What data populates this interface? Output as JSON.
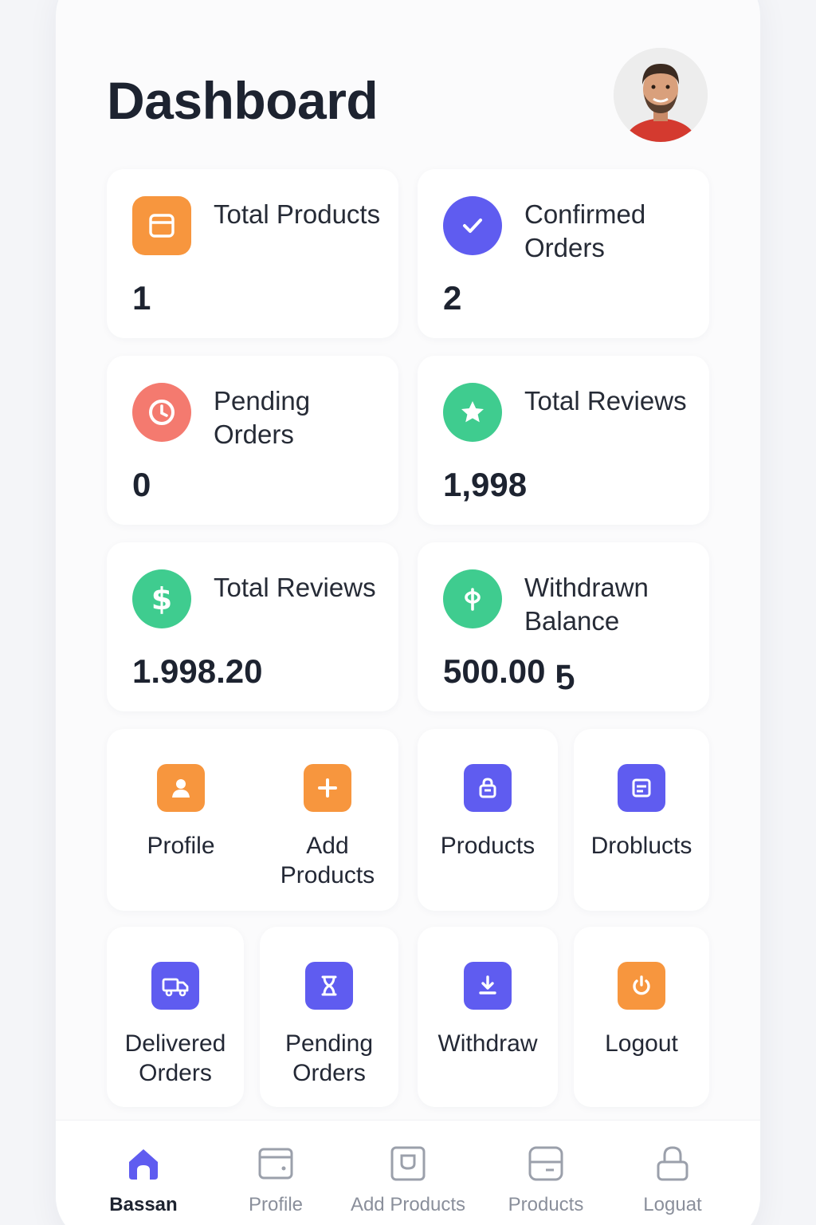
{
  "header": {
    "title": "Dashboard"
  },
  "stats": [
    {
      "label": "Total Products",
      "value": "1",
      "icon": "box-icon",
      "color": "#f7963e"
    },
    {
      "label": "Confirmed Orders",
      "value": "2",
      "icon": "check-icon",
      "color": "#5f5cf0"
    },
    {
      "label": "Pending Orders",
      "value": "0",
      "icon": "clock-icon",
      "color": "#f47a6f"
    },
    {
      "label": "Total Reviews",
      "value": "1,998",
      "icon": "star-icon",
      "color": "#3fcc8f"
    },
    {
      "label": "Total Reviews",
      "value": "1.998.20",
      "icon": "dollar-icon",
      "color": "#3fcc8f"
    },
    {
      "label": "Withdrawn Balance",
      "value": "500.00 ҕ",
      "icon": "currency-icon",
      "color": "#3fcc8f"
    }
  ],
  "actions": [
    {
      "label": "Profile",
      "icon": "user-icon",
      "color": "#f7963e"
    },
    {
      "label": "Add Products",
      "icon": "plus-icon",
      "color": "#f7963e"
    },
    {
      "label": "Products",
      "icon": "lock-bag-icon",
      "color": "#5f5cf0"
    },
    {
      "label": "Droblucts",
      "icon": "list-icon",
      "color": "#5f5cf0"
    },
    {
      "label": "Delivered Orders",
      "icon": "truck-icon",
      "color": "#5f5cf0"
    },
    {
      "label": "Pending Orders",
      "icon": "hourglass-icon",
      "color": "#5f5cf0"
    },
    {
      "label": "Withdraw",
      "icon": "download-icon",
      "color": "#5f5cf0"
    },
    {
      "label": "Logout",
      "icon": "power-icon",
      "color": "#f7963e"
    }
  ],
  "nav": [
    {
      "label": "Bassan",
      "icon": "home-icon",
      "active": true
    },
    {
      "label": "Profile",
      "icon": "wallet-icon"
    },
    {
      "label": "Add Products",
      "icon": "tag-icon"
    },
    {
      "label": "Products",
      "icon": "card-icon"
    },
    {
      "label": "Loguat",
      "icon": "lock-icon"
    }
  ]
}
